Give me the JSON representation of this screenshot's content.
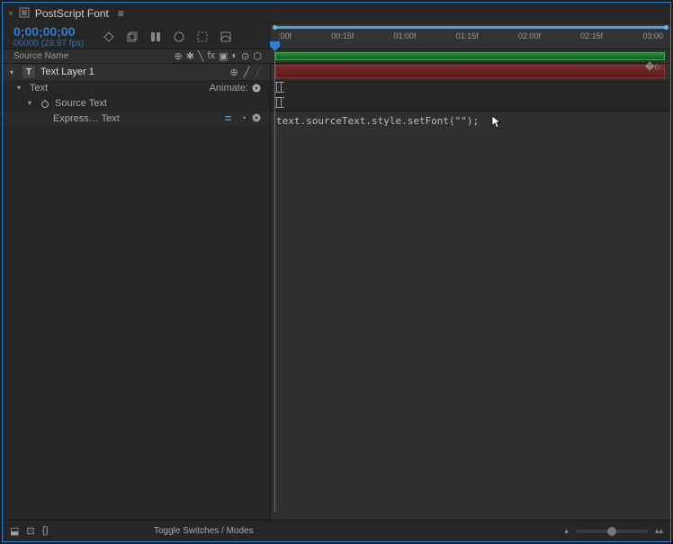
{
  "tab": {
    "title": "PostScript Font"
  },
  "timecode": {
    "value": "0;00;00;00",
    "fps": "00000 (29.97 fps)"
  },
  "ruler": {
    "marks": [
      ":00f",
      "00:15f",
      "01:00f",
      "01:15f",
      "02:00f",
      "02:15f",
      "03:00"
    ]
  },
  "columns": {
    "source": "Source Name"
  },
  "layer": {
    "name": "Text Layer 1",
    "props": {
      "text": "Text",
      "animate": "Animate:",
      "source_text": "Source Text",
      "expression": "Express… Text"
    }
  },
  "expression": {
    "code": "text.sourceText.style.setFont(\"\");"
  },
  "footer": {
    "toggle": "Toggle Switches / Modes"
  }
}
